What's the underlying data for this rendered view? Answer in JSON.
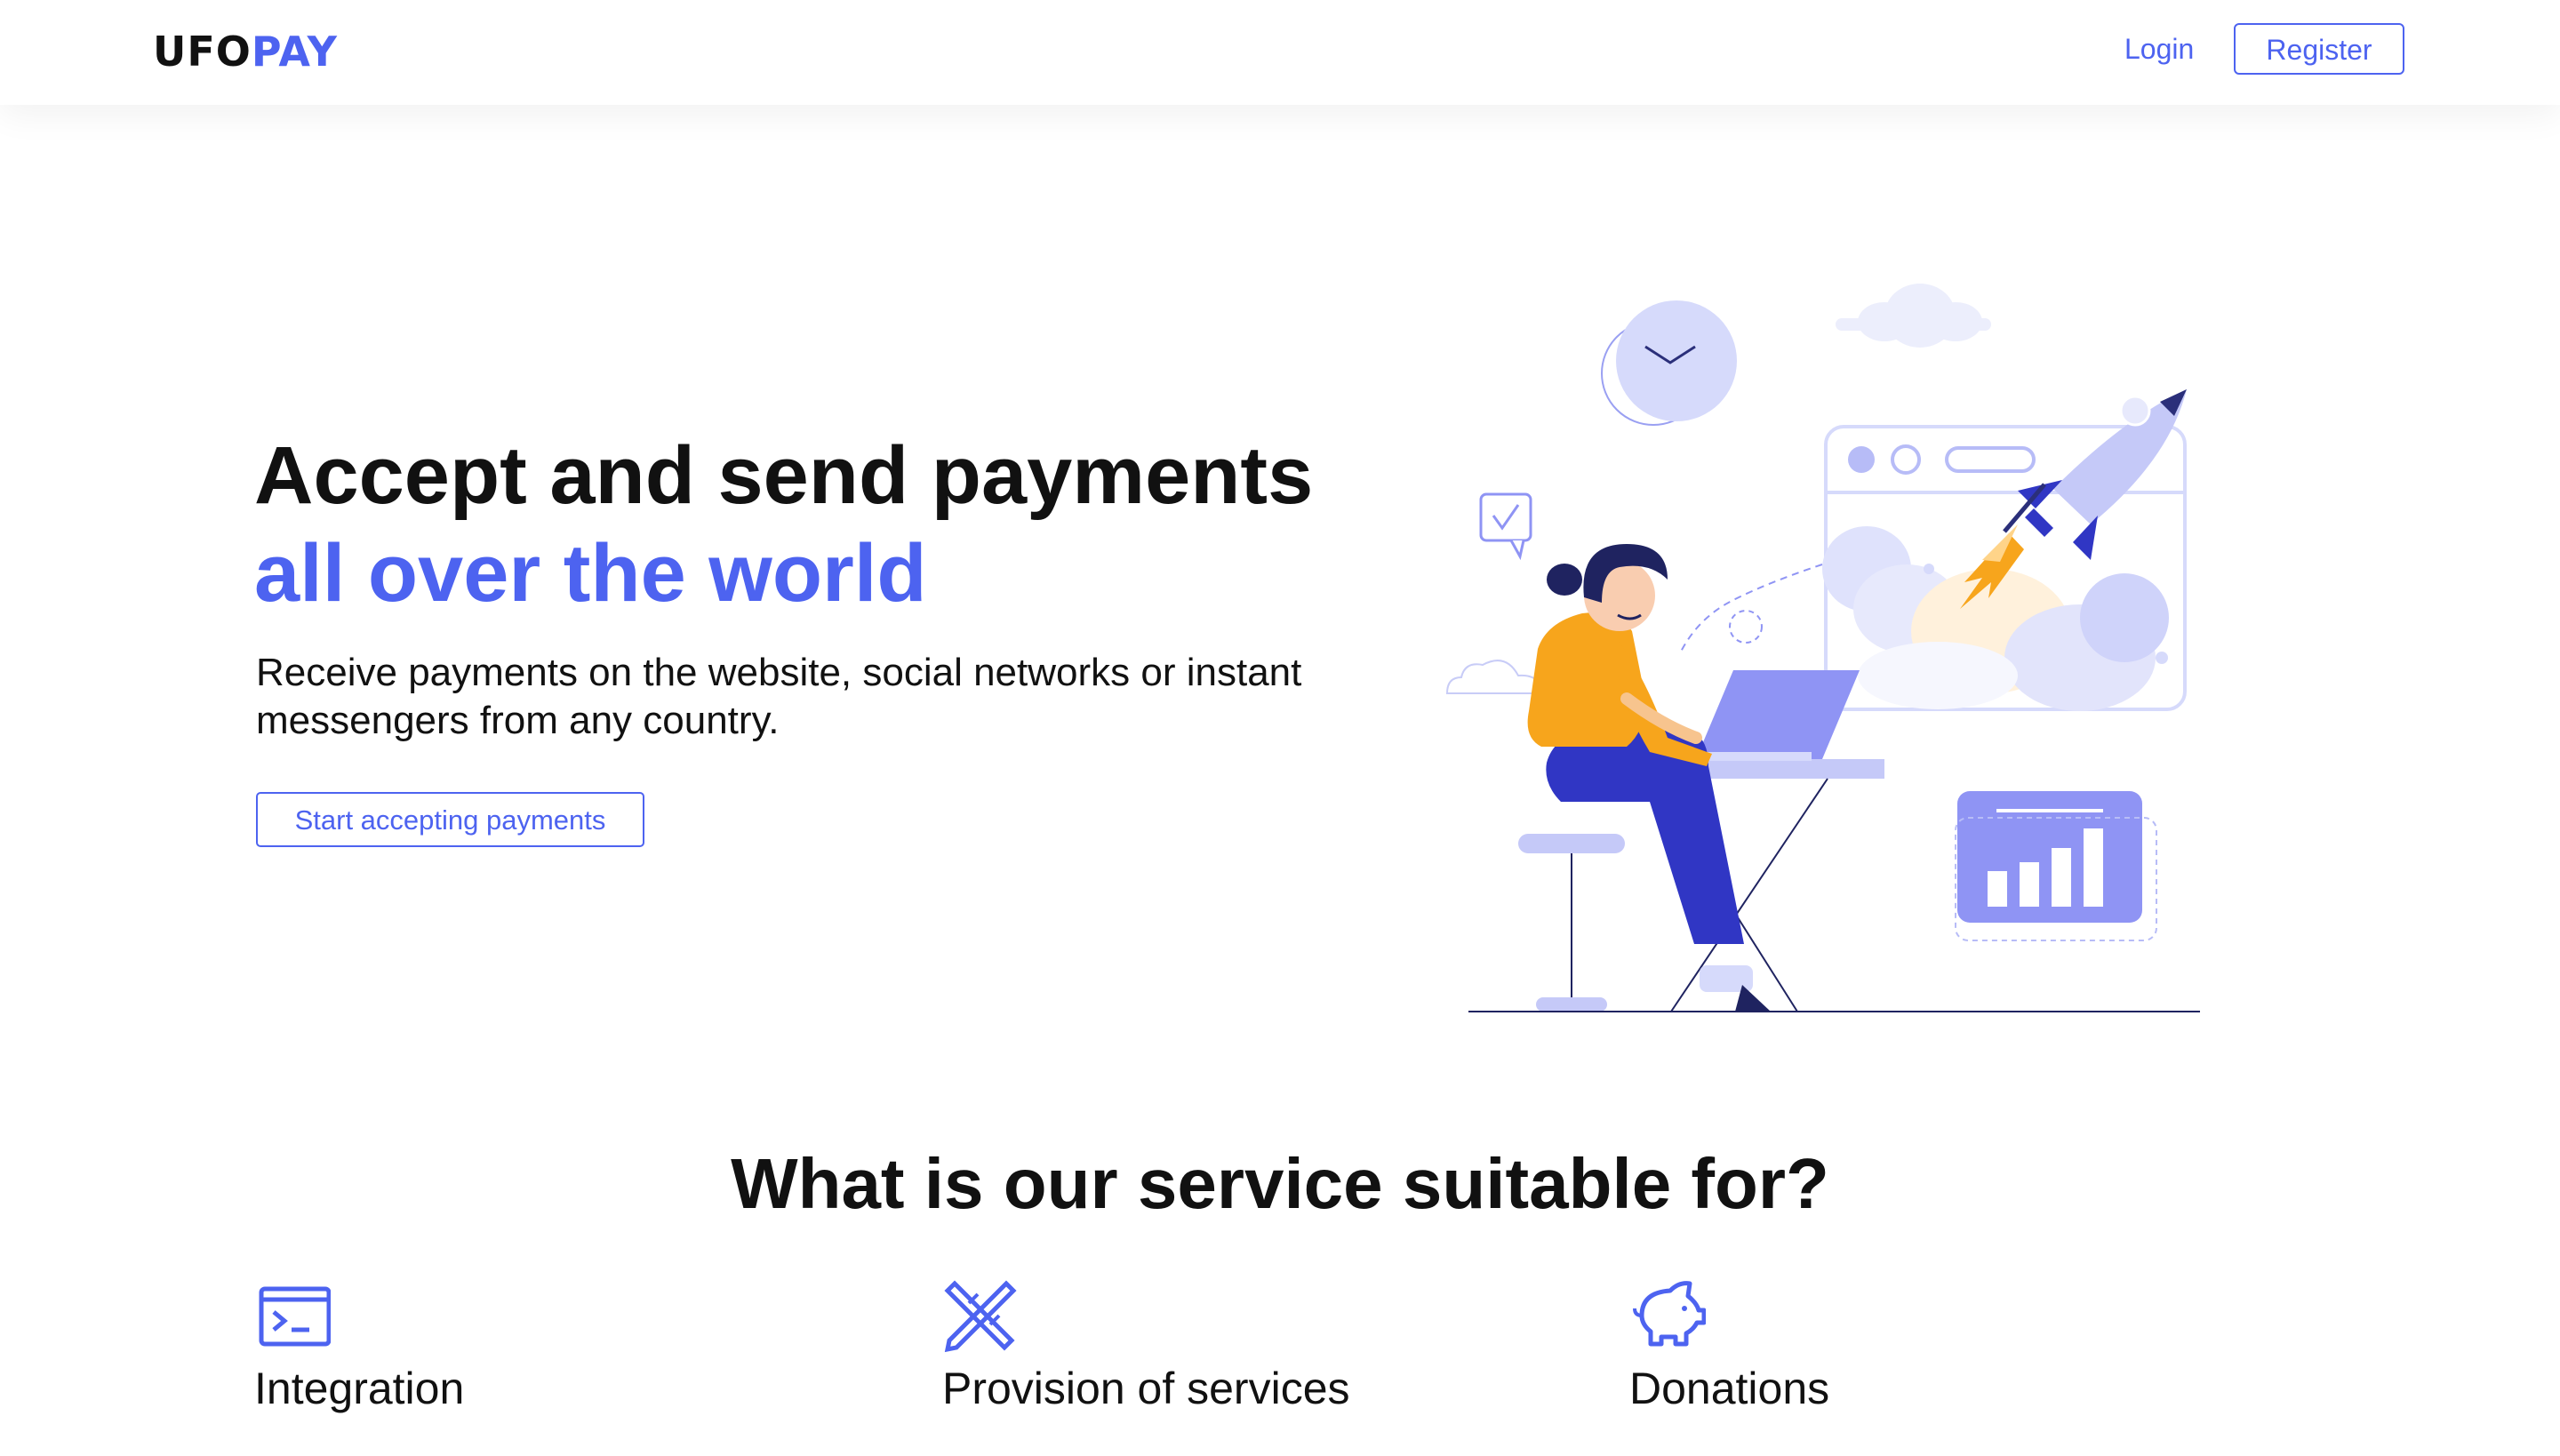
{
  "header": {
    "logo": {
      "part1": "UFO",
      "part2": "PAY"
    },
    "login_label": "Login",
    "register_label": "Register"
  },
  "hero": {
    "title_line1": "Accept and send payments",
    "title_line2": "all over the world",
    "subtitle": "Receive payments on the website, social networks or instant messengers from any country.",
    "cta_label": "Start accepting payments"
  },
  "features": {
    "title": "What is our service suitable for?",
    "items": [
      {
        "label": "Integration",
        "icon": "terminal-icon"
      },
      {
        "label": "Provision of services",
        "icon": "tools-icon"
      },
      {
        "label": "Donations",
        "icon": "piggy-bank-icon"
      }
    ]
  },
  "colors": {
    "accent": "#4d63f0",
    "text": "#111111",
    "illustration_light": "#d6dafb",
    "illustration_mid": "#8f94f4",
    "illustration_dark": "#3036c4",
    "illustration_orange": "#f7a51c"
  }
}
